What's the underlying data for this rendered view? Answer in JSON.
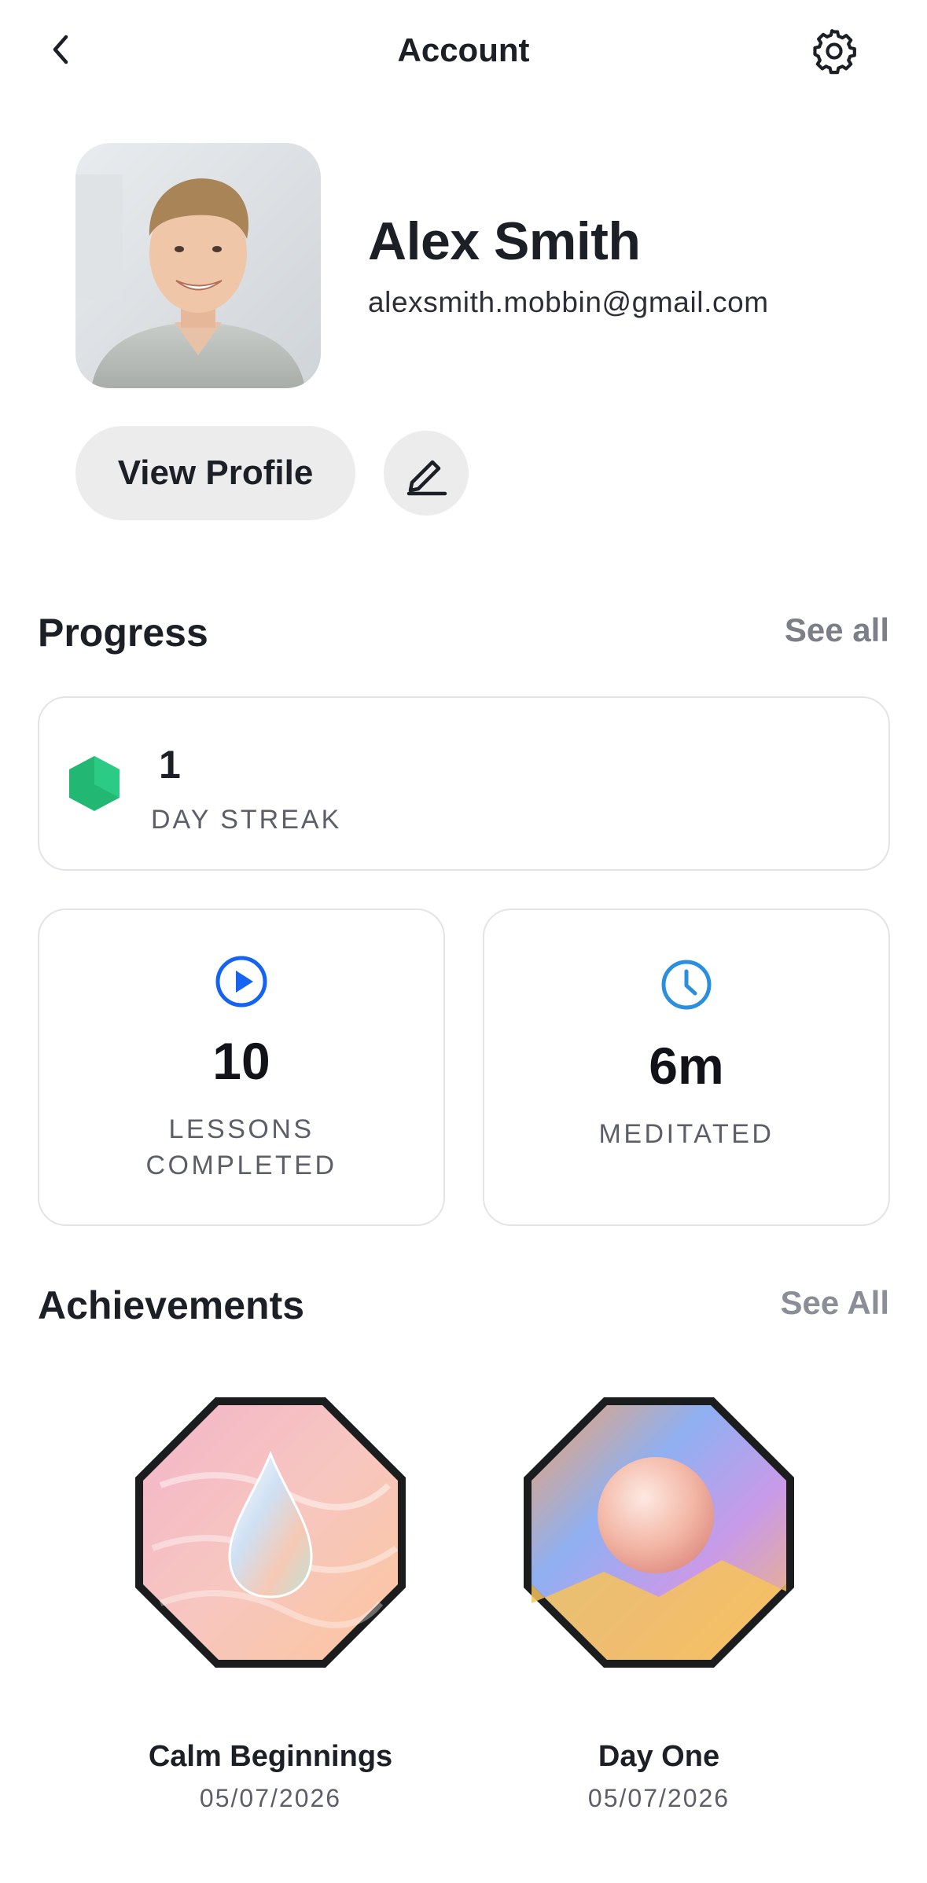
{
  "header": {
    "title": "Account",
    "back_icon": "chevron-left-icon",
    "settings_icon": "gear-icon"
  },
  "profile": {
    "name": "Alex Smith",
    "email": "alexsmith.mobbin@gmail.com",
    "view_profile_label": "View Profile",
    "edit_icon": "pencil-icon"
  },
  "progress": {
    "title": "Progress",
    "see_all": "See all",
    "streak": {
      "value": "1",
      "label": "DAY STREAK",
      "color": "#22b874"
    },
    "lessons": {
      "value": "10",
      "label_line1": "LESSONS",
      "label_line2": "COMPLETED",
      "icon": "play-circle-icon",
      "color": "#1463f3"
    },
    "meditated": {
      "value": "6m",
      "label": "MEDITATED",
      "icon": "clock-icon",
      "color": "#2b8fe0"
    }
  },
  "achievements": {
    "title": "Achievements",
    "see_all": "See All",
    "items": [
      {
        "name": "Calm Beginnings",
        "date": "05/07/2026",
        "icon": "water-drop-badge-icon"
      },
      {
        "name": "Day One",
        "date": "05/07/2026",
        "icon": "pearl-badge-icon"
      }
    ]
  }
}
